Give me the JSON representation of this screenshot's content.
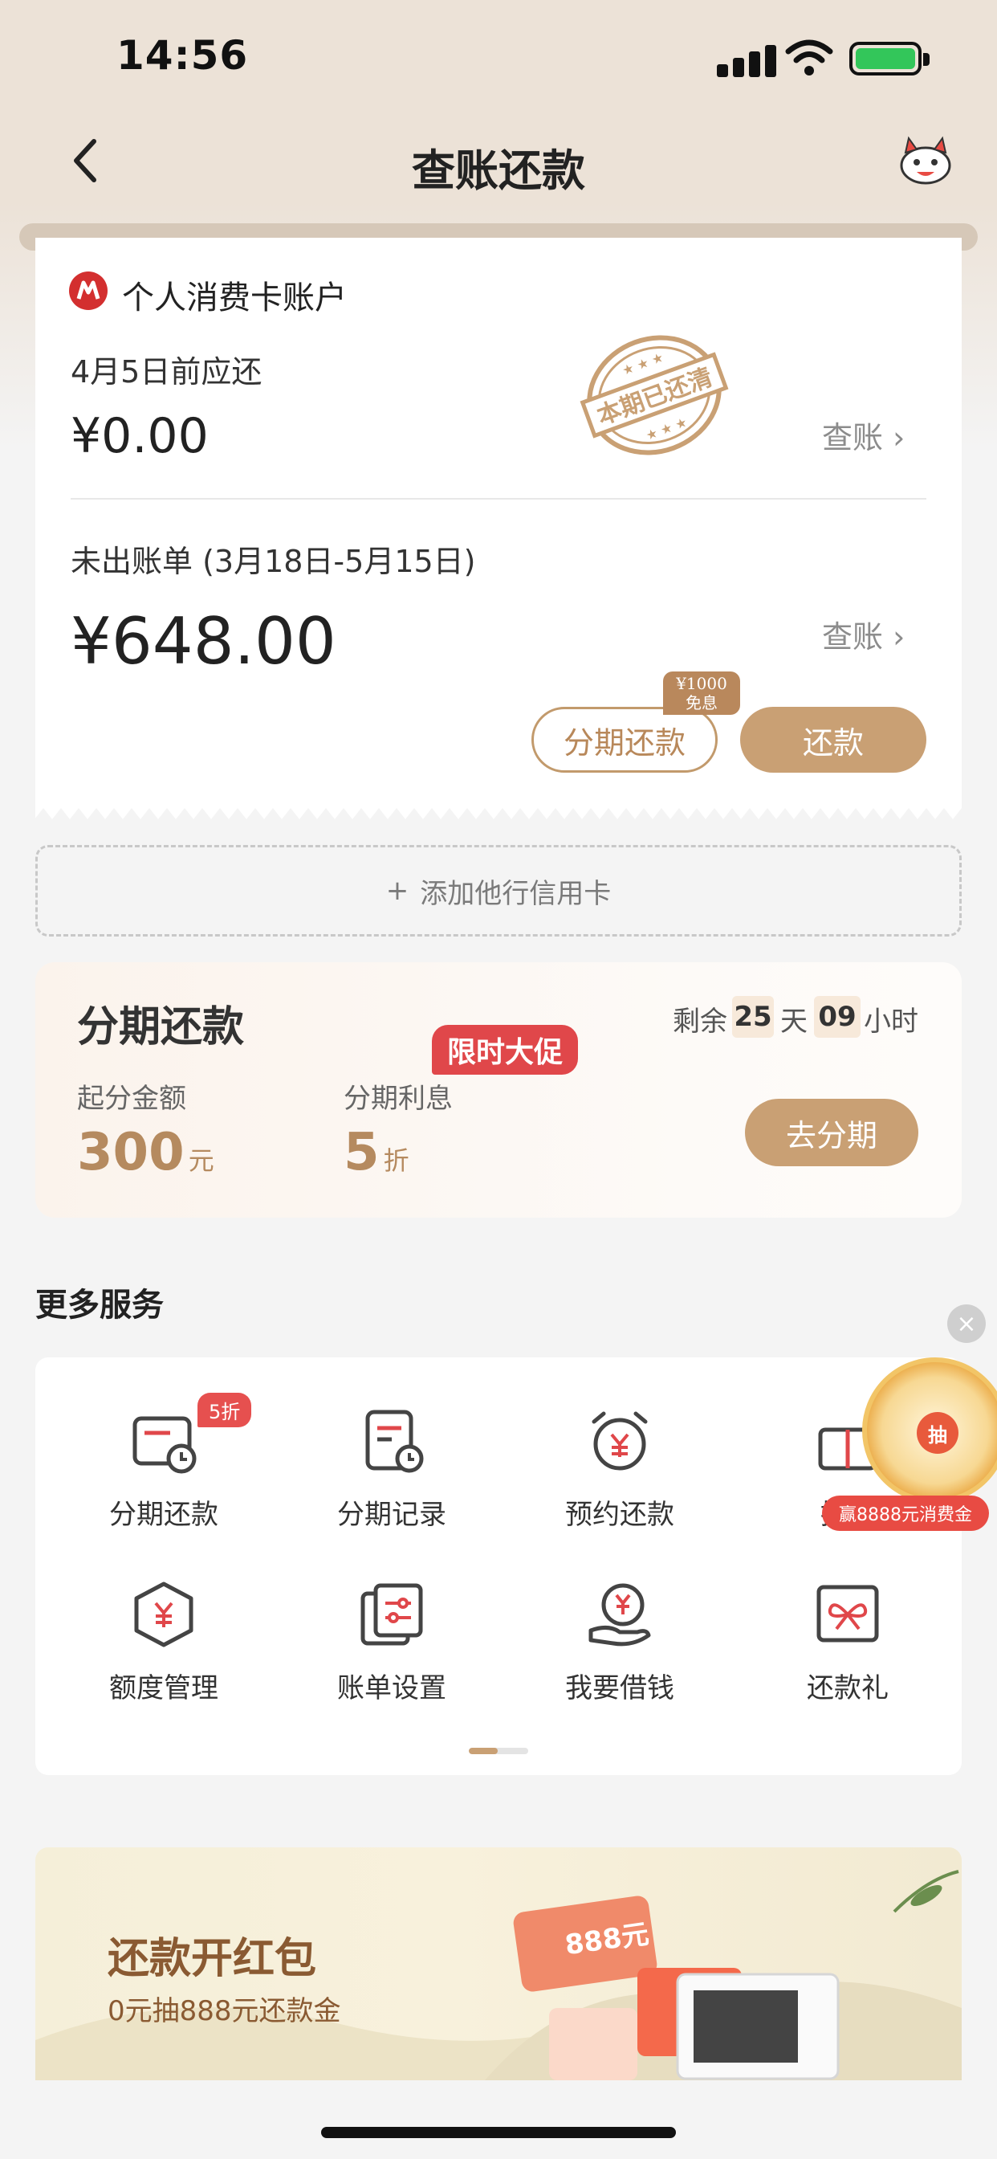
{
  "status_bar": {
    "time": "14:56"
  },
  "nav": {
    "title": "查账还款"
  },
  "account_card": {
    "title": "个人消费卡账户",
    "due_label": "4月5日前应还",
    "due_amount": "¥0.00",
    "stamp_text": "本期已还清",
    "view_label": "查账",
    "unbilled_label": "未出账单 (3月18日-5月15日)",
    "unbilled_amount": "¥648.00",
    "installment_button": "分期还款",
    "badge_line1": "¥1000",
    "badge_line2": "免息",
    "repay_button": "还款"
  },
  "add_card": {
    "label": "添加他行信用卡"
  },
  "installment_promo": {
    "title": "分期还款",
    "remain_prefix": "剩余",
    "days": "25",
    "day_unit": "天",
    "hours": "09",
    "hour_unit": "小时",
    "min_amount_label": "起分金额",
    "min_amount_value": "300",
    "min_amount_unit": "元",
    "rate_label": "分期利息",
    "rate_value": "5",
    "rate_unit": "折",
    "limited_badge": "限时大促",
    "go_button": "去分期"
  },
  "more_services": {
    "title": "更多服务",
    "items": [
      {
        "label": "分期还款",
        "icon": "installment-clock-icon",
        "badge": "5折"
      },
      {
        "label": "分期记录",
        "icon": "record-clock-icon"
      },
      {
        "label": "预约还款",
        "icon": "alarm-yen-icon"
      },
      {
        "label": "推荐",
        "icon": "gift-icon"
      },
      {
        "label": "额度管理",
        "icon": "hexagon-yen-icon"
      },
      {
        "label": "账单设置",
        "icon": "bill-settings-icon"
      },
      {
        "label": "我要借钱",
        "icon": "hand-yen-icon"
      },
      {
        "label": "还款礼",
        "icon": "gift-box-icon"
      }
    ]
  },
  "floating_wheel": {
    "center_text": "抽",
    "label": "赢8888元消费金"
  },
  "banner": {
    "title": "还款开红包",
    "subtitle": "0元抽888元还款金",
    "coupon_text": "888元"
  },
  "colors": {
    "accent": "#c9a074",
    "header_bg": "#ece2d7",
    "red": "#e0474a"
  }
}
